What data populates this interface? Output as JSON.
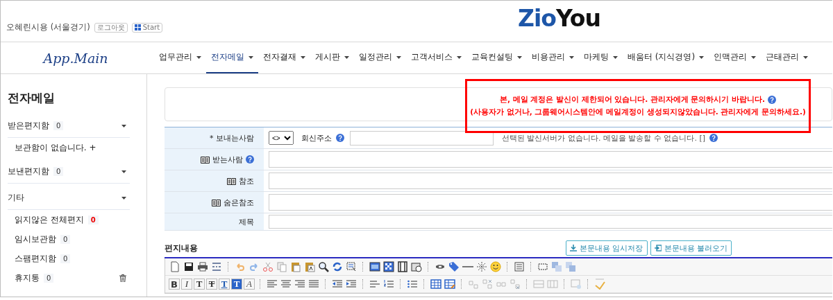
{
  "header": {
    "user": "오혜린시용 (서울경기)",
    "logout_button": "로그아웃",
    "start_button": "Start",
    "logo_part_1": "Zio",
    "logo_part_2": "You"
  },
  "nav": {
    "logo": "App.Main",
    "items": [
      {
        "label": "업무관리",
        "selected": false
      },
      {
        "label": "전자메일",
        "selected": true
      },
      {
        "label": "전자결재",
        "selected": false
      },
      {
        "label": "게시판",
        "selected": false
      },
      {
        "label": "일정관리",
        "selected": false
      },
      {
        "label": "고객서비스",
        "selected": false
      },
      {
        "label": "교육컨설팅",
        "selected": false
      },
      {
        "label": "비용관리",
        "selected": false
      },
      {
        "label": "마케팅",
        "selected": false
      },
      {
        "label": "배움터 (지식경영)",
        "selected": false
      },
      {
        "label": "인맥관리",
        "selected": false
      },
      {
        "label": "근태관리",
        "selected": false
      }
    ]
  },
  "sidebar": {
    "title": "전자메일",
    "sections": [
      {
        "label": "받은편지함",
        "count": "0",
        "children": [
          {
            "kind": "note",
            "label": "보관함이 없습니다. +"
          }
        ]
      },
      {
        "label": "보낸편지함",
        "count": "0"
      },
      {
        "label": "기타",
        "children": [
          {
            "kind": "folder",
            "label": "읽지않은 전체편지",
            "count": "0",
            "unread": true
          },
          {
            "kind": "folder",
            "label": "임시보관함",
            "count": "0",
            "unread": false
          },
          {
            "kind": "folder",
            "label": "스팸편지함",
            "count": "0",
            "unread": false
          },
          {
            "kind": "trash",
            "label": "휴지통",
            "count": "0",
            "unread": false
          }
        ]
      }
    ]
  },
  "notice": {
    "lines": [
      "본, 메일 계정은 발신이 제한되어 있습니다. 관리자에게 문의하시기 바랍니다.",
      "(사용자가 없거나, 그룹웨어시스템안에 메일계정이 생성되지않았습니다. 관리자에게 문의하세요.)"
    ]
  },
  "form": {
    "rows": [
      {
        "kind": "sender",
        "label": "* 보내는사람",
        "select_value": "<>",
        "reply_label": "회신주소",
        "note": "선택된 발신서버가 없습니다. 메일을 발송할 수 없습니다. []"
      },
      {
        "kind": "address",
        "label": "받는사람",
        "help": true
      },
      {
        "kind": "address",
        "label": "참조",
        "help": false
      },
      {
        "kind": "address",
        "label": "숨은참조",
        "help": false
      },
      {
        "kind": "plain",
        "label": "제목"
      }
    ]
  },
  "editor": {
    "title": "편지내용",
    "buttons": [
      {
        "kind": "save",
        "label": "본문내용 임시저장"
      },
      {
        "kind": "load",
        "label": "본문내용 불러오기"
      }
    ],
    "format_buttons": [
      {
        "kind": "bold",
        "label": "B"
      },
      {
        "kind": "italic",
        "label": "I"
      },
      {
        "kind": "plain",
        "label": "T"
      },
      {
        "kind": "strike",
        "label": "T"
      },
      {
        "kind": "underline",
        "label": "T"
      },
      {
        "kind": "highlight",
        "label": "T"
      },
      {
        "kind": "clear",
        "label": "A"
      }
    ]
  }
}
